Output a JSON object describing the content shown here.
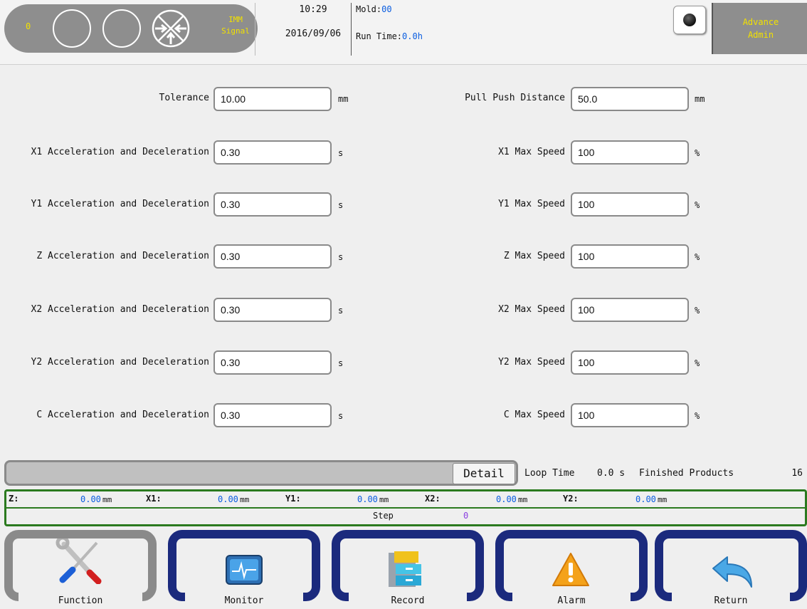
{
  "header": {
    "counter": "0",
    "imm_signal_line1": "IMM",
    "imm_signal_line2": "Signal",
    "time": "10:29",
    "date": "2016/09/06",
    "mold_label": "Mold:",
    "mold_value": "00",
    "runtime_label": "Run Time:",
    "runtime_value": "0.0h",
    "user_level": "Advance",
    "user_name": "Admin",
    "icons": [
      "status-circle-icon",
      "status-circle-icon",
      "clamp-arrows-icon",
      "camera-icon"
    ]
  },
  "form": {
    "left": [
      {
        "label": "Tolerance",
        "value": "10.00",
        "unit": "mm"
      },
      {
        "label": "X1 Acceleration and Deceleration",
        "value": "0.30",
        "unit": "s"
      },
      {
        "label": "Y1 Acceleration and Deceleration",
        "value": "0.30",
        "unit": "s"
      },
      {
        "label": "Z Acceleration and Deceleration",
        "value": "0.30",
        "unit": "s"
      },
      {
        "label": "X2 Acceleration and Deceleration",
        "value": "0.30",
        "unit": "s"
      },
      {
        "label": "Y2 Acceleration and Deceleration",
        "value": "0.30",
        "unit": "s"
      },
      {
        "label": "C Acceleration and Deceleration",
        "value": "0.30",
        "unit": "s"
      }
    ],
    "right": [
      {
        "label": "Pull Push Distance",
        "value": "50.0",
        "unit": "mm"
      },
      {
        "label": "X1 Max Speed",
        "value": "100",
        "unit": "%"
      },
      {
        "label": "Y1 Max Speed",
        "value": "100",
        "unit": "%"
      },
      {
        "label": "Z Max Speed",
        "value": "100",
        "unit": "%"
      },
      {
        "label": "X2 Max Speed",
        "value": "100",
        "unit": "%"
      },
      {
        "label": "Y2 Max Speed",
        "value": "100",
        "unit": "%"
      },
      {
        "label": "C Max Speed",
        "value": "100",
        "unit": "%"
      }
    ]
  },
  "status": {
    "detail_label": "Detail",
    "loop_time_label": "Loop Time",
    "loop_time_value": "0.0 s",
    "finished_label": "Finished Products",
    "finished_value": "16"
  },
  "coords": {
    "axes": [
      {
        "label": "Z:",
        "value": "0.00",
        "unit": "mm"
      },
      {
        "label": "X1:",
        "value": "0.00",
        "unit": "mm"
      },
      {
        "label": "Y1:",
        "value": "0.00",
        "unit": "mm"
      },
      {
        "label": "X2:",
        "value": "0.00",
        "unit": "mm"
      },
      {
        "label": "Y2:",
        "value": "0.00",
        "unit": "mm"
      }
    ],
    "step_label": "Step",
    "step_value": "0"
  },
  "nav": [
    {
      "label": "Function",
      "icon": "wrench-screwdriver-icon",
      "active": true
    },
    {
      "label": "Monitor",
      "icon": "monitor-icon",
      "active": false
    },
    {
      "label": "Record",
      "icon": "file-cabinet-icon",
      "active": false
    },
    {
      "label": "Alarm",
      "icon": "warning-icon",
      "active": false
    },
    {
      "label": "Return",
      "icon": "return-arrow-icon",
      "active": false
    }
  ],
  "colors": {
    "accent_yellow": "#f2e100",
    "value_blue": "#0a5de0",
    "nav_blue": "#1b2a7d",
    "status_green": "#2b7a1f"
  }
}
